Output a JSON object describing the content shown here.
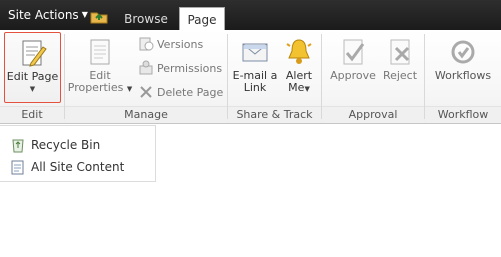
{
  "top": {
    "site_actions": "Site Actions",
    "tabs": [
      {
        "label": "Browse"
      },
      {
        "label": "Page"
      }
    ]
  },
  "ribbon": {
    "groups": {
      "edit": {
        "label": "Edit",
        "edit_page": "Edit Page"
      },
      "manage": {
        "label": "Manage",
        "edit_properties_line1": "Edit",
        "edit_properties_line2": "Properties",
        "versions": "Versions",
        "permissions": "Permissions",
        "delete_page": "Delete Page"
      },
      "share_track": {
        "label": "Share & Track",
        "email_line1": "E-mail a",
        "email_line2": "Link",
        "alert_line1": "Alert",
        "alert_line2": "Me"
      },
      "approval": {
        "label": "Approval",
        "approve": "Approve",
        "reject": "Reject"
      },
      "workflow": {
        "label": "Workflow",
        "workflows": "Workflows"
      }
    }
  },
  "menu": {
    "items": [
      {
        "label": "Recycle Bin"
      },
      {
        "label": "All Site Content"
      }
    ]
  }
}
